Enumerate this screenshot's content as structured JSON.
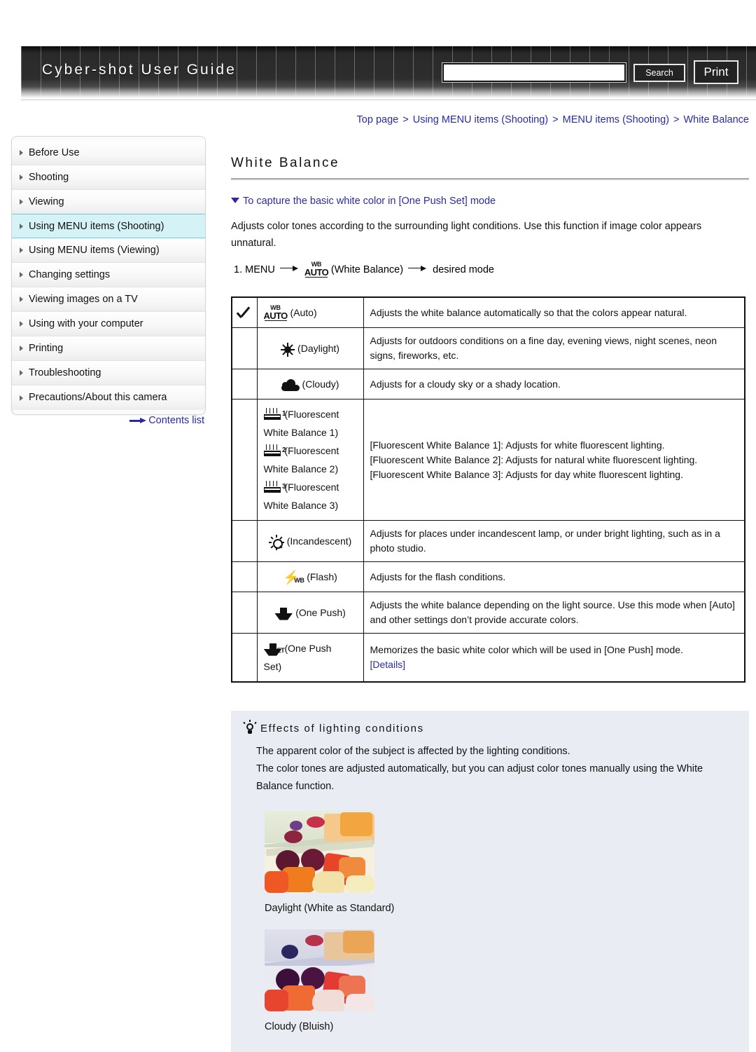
{
  "header": {
    "title": "Cyber-shot User Guide",
    "search_value": "",
    "search_placeholder": "",
    "search_label": "Search",
    "print_label": "Print"
  },
  "breadcrumb": {
    "items": [
      "Top page",
      "Using MENU items (Shooting)",
      "MENU items (Shooting)",
      "White Balance"
    ],
    "separator": ">"
  },
  "sidebar": {
    "items": [
      {
        "label": "Before Use",
        "active": false
      },
      {
        "label": "Shooting",
        "active": false
      },
      {
        "label": "Viewing",
        "active": false
      },
      {
        "label": "Using MENU items (Shooting)",
        "active": true
      },
      {
        "label": "Using MENU items (Viewing)",
        "active": false
      },
      {
        "label": "Changing settings",
        "active": false
      },
      {
        "label": "Viewing images on a TV",
        "active": false
      },
      {
        "label": "Using with your computer",
        "active": false
      },
      {
        "label": "Printing",
        "active": false
      },
      {
        "label": "Troubleshooting",
        "active": false
      },
      {
        "label": "Precautions/About this camera",
        "active": false
      }
    ],
    "contents_list_label": "Contents list"
  },
  "main": {
    "page_title": "White Balance",
    "jump_link": "To capture the basic white color in [One Push Set] mode",
    "intro": "Adjusts color tones according to the surrounding light conditions. Use this function if image color appears unnatural.",
    "step": {
      "number": "1.",
      "menu_label": "MENU",
      "icon_name": "wb-auto-icon",
      "icon_text_top": "WB",
      "icon_text_bottom": "AUTO",
      "middle_label": "(White Balance)",
      "end_label": "desired mode"
    },
    "table": {
      "rows": [
        {
          "checked": true,
          "icon": "wb-auto-icon",
          "mode_lines": [
            "(Auto)"
          ],
          "desc": "Adjusts the white balance automatically so that the colors appear natural."
        },
        {
          "checked": false,
          "icon": "daylight-sun-icon",
          "mode_lines": [
            "(Daylight)"
          ],
          "desc": "Adjusts for outdoors conditions on a fine day, evening views, night scenes, neon signs, fireworks, etc."
        },
        {
          "checked": false,
          "icon": "cloudy-cloud-icon",
          "mode_lines": [
            "(Cloudy)"
          ],
          "desc": "Adjusts for a cloudy sky or a shady location."
        },
        {
          "checked": false,
          "icon": "fluorescent-icon",
          "mode_lines": [
            "(Fluorescent White Balance 1)",
            "(Fluorescent White Balance 2)",
            "(Fluorescent White Balance 3)"
          ],
          "desc_lines": [
            "[Fluorescent White Balance 1]: Adjusts for white fluorescent lighting.",
            "[Fluorescent White Balance 2]: Adjusts for natural white fluorescent lighting.",
            "[Fluorescent White Balance 3]: Adjusts for day white fluorescent lighting."
          ]
        },
        {
          "checked": false,
          "icon": "incandescent-icon",
          "mode_lines": [
            "(Incandescent)"
          ],
          "desc": "Adjusts for places under incandescent lamp, or under bright lighting, such as in a photo studio."
        },
        {
          "checked": false,
          "icon": "flash-wb-icon",
          "mode_lines": [
            "(Flash)"
          ],
          "desc": "Adjusts for the flash conditions."
        },
        {
          "checked": false,
          "icon": "one-push-icon",
          "mode_lines": [
            "(One Push)"
          ],
          "desc": "Adjusts the white balance depending on the light source. Use this mode when [Auto] and other settings don’t provide accurate colors."
        },
        {
          "checked": false,
          "icon": "one-push-set-icon",
          "mode_lines": [
            "(One Push Set)"
          ],
          "desc": "Memorizes the basic white color which will be used in [One Push] mode.",
          "desc_link": "[Details]"
        }
      ],
      "fluorescent_labels": {
        "row1_part1": "(Fluorescent",
        "row1_part2": "White Balance 1)",
        "row2_part1": "(Fluorescent",
        "row2_part2": "White Balance 2)",
        "row3_part1": "(Fluorescent",
        "row3_part2": "White Balance 3)"
      },
      "one_push_set_label": {
        "part1": "(One Push",
        "part2": "Set)"
      }
    },
    "tip": {
      "heading": "Effects of lighting conditions",
      "line1": "The apparent color of the subject is affected by the lighting conditions.",
      "line2": "The color tones are adjusted automatically, but you can adjust color tones manually using the White Balance function.",
      "samples": [
        {
          "caption": "Daylight (White as Standard)",
          "tone": "warm"
        },
        {
          "caption": "Cloudy (Bluish)",
          "tone": "cool"
        }
      ]
    }
  },
  "colors": {
    "link": "#2a2aa5",
    "active_nav_bg": "#d5f3f7",
    "active_nav_border": "#66cfe0",
    "tip_bg": "#e9edf3",
    "header_dark": "#2a2a2a"
  }
}
